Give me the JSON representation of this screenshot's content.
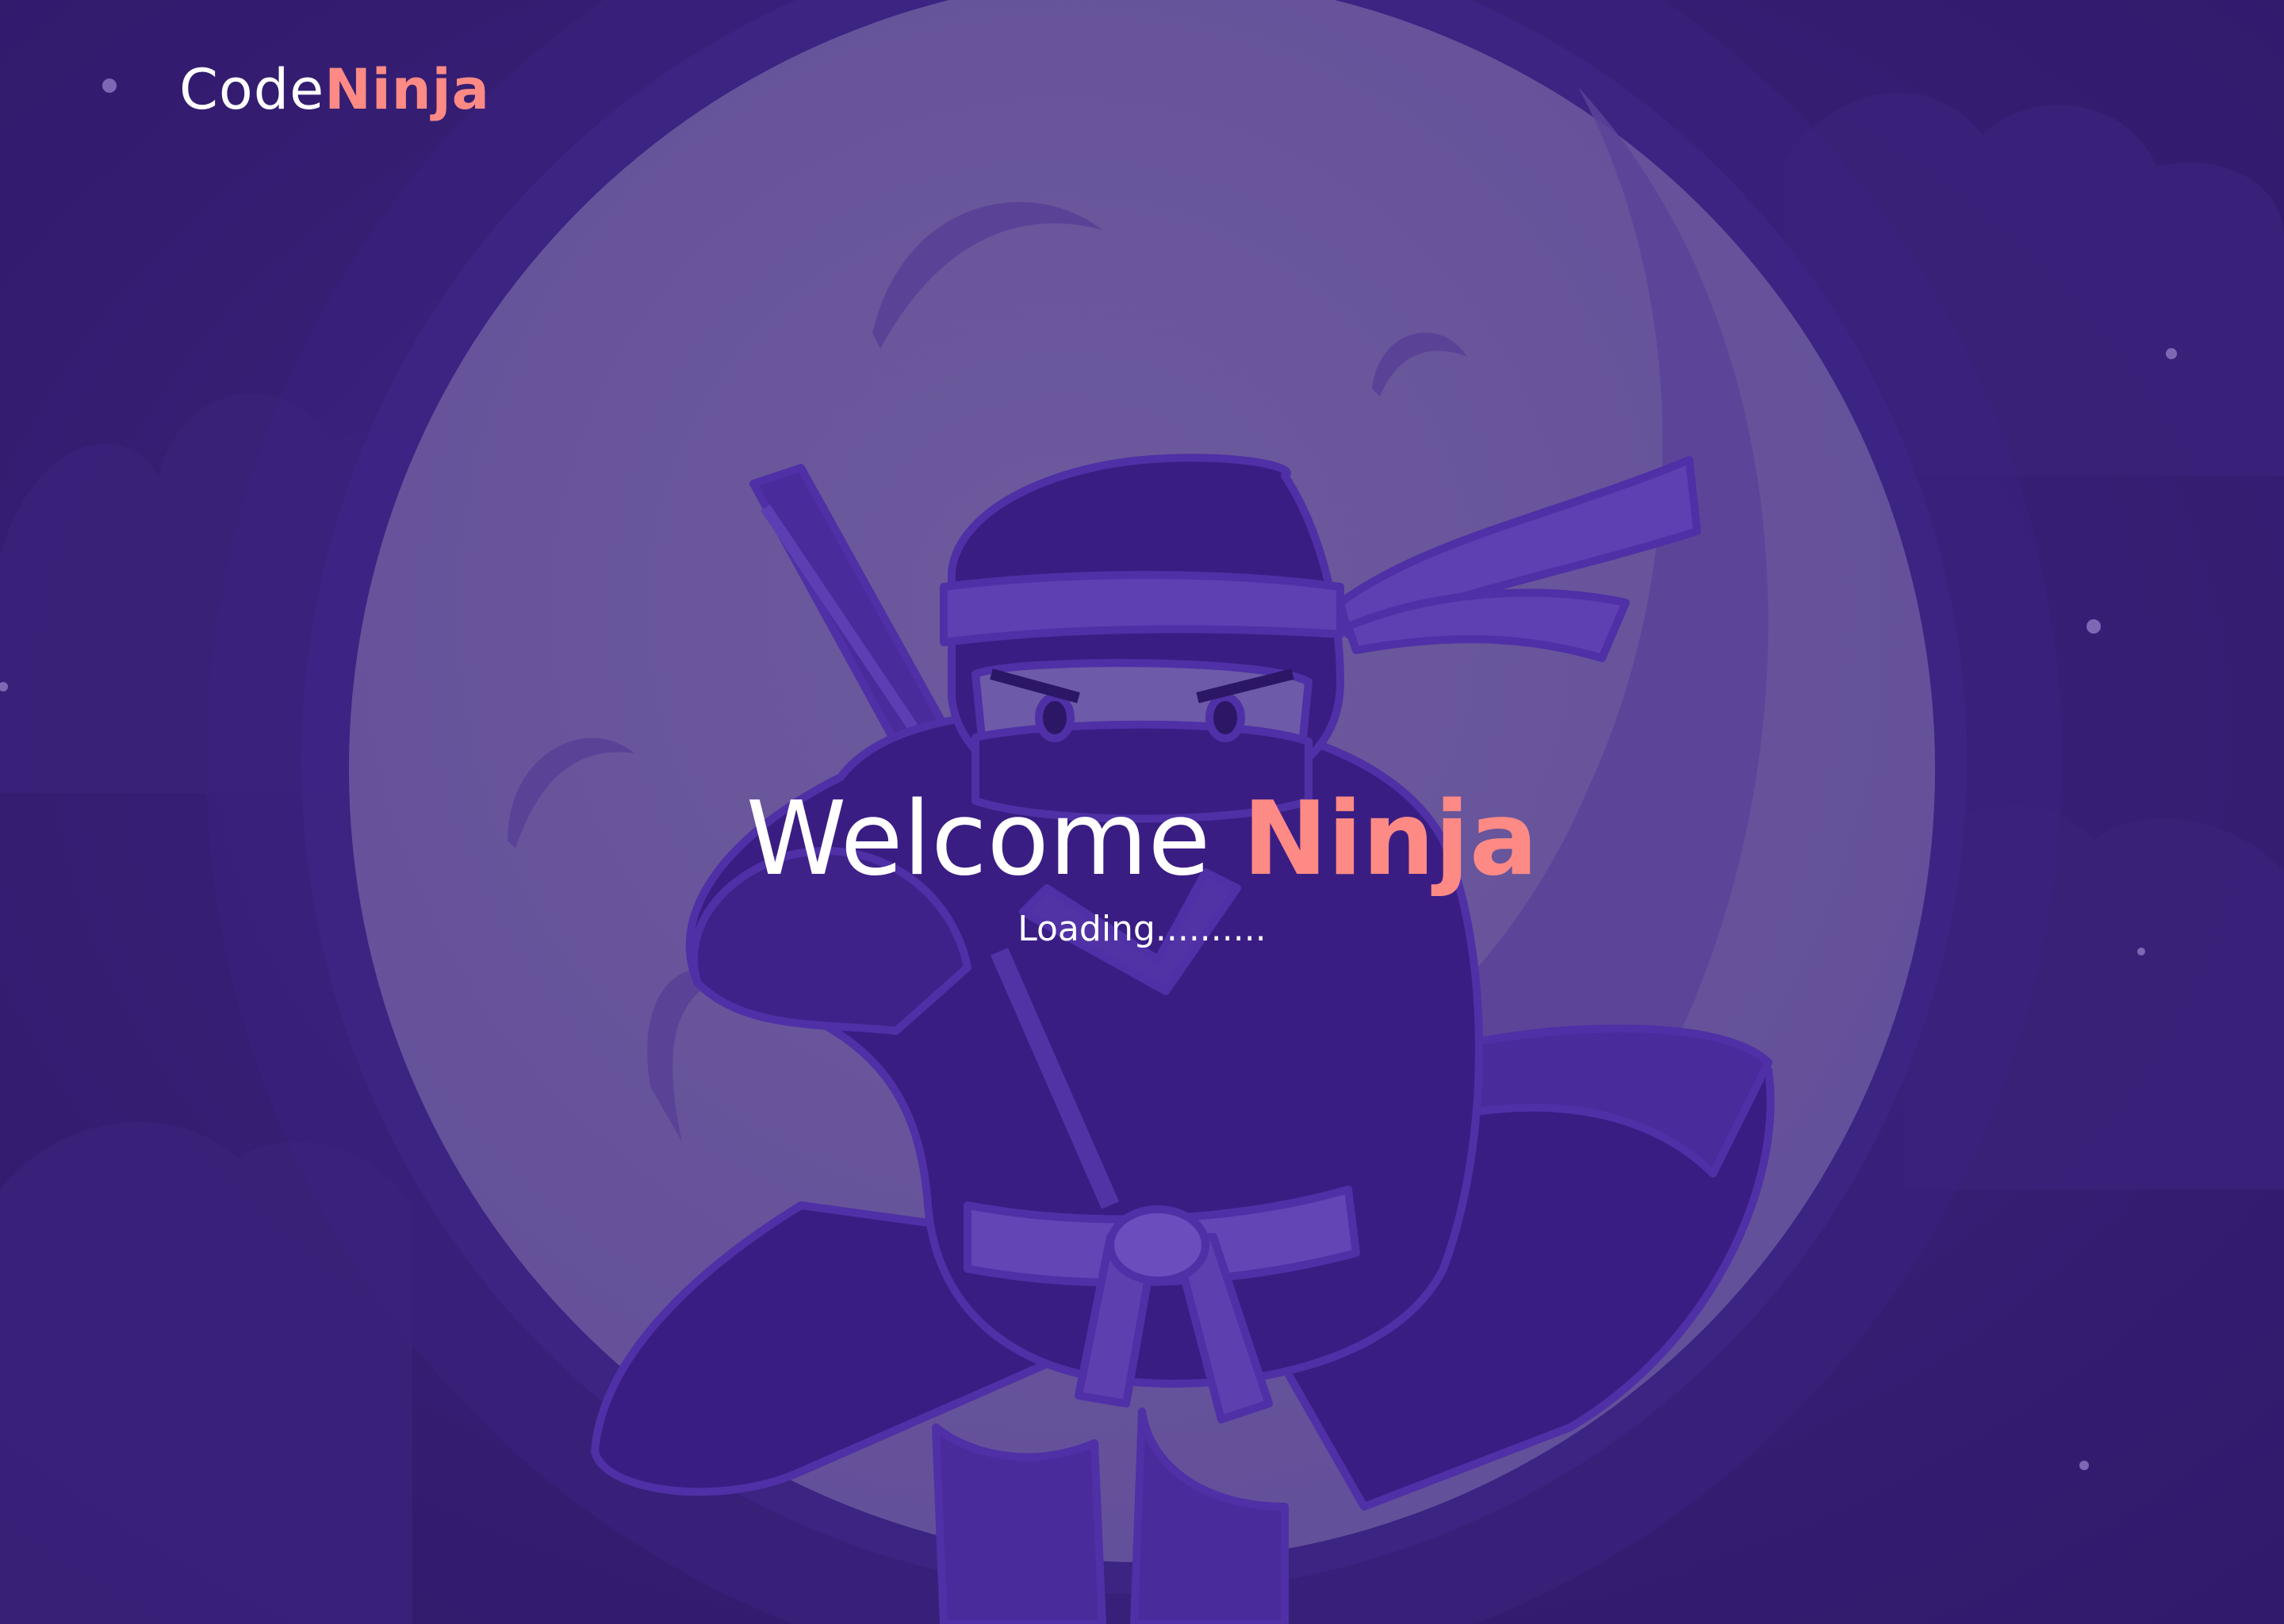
{
  "brand": {
    "part_a": "Code",
    "part_b": "Ninja"
  },
  "hero": {
    "welcome_word": "Welcome",
    "highlight_word": "Ninja",
    "loading_text": "Loading.........."
  },
  "colors": {
    "background": "#341c72",
    "moon": "#6a5699",
    "moon_halo": "#3f2683",
    "ninja_body": "#3d1f86",
    "ninja_outline": "#4a2b9c",
    "accent": "#fd8a85",
    "text": "#ffffff"
  },
  "illustration": {
    "icon": "ninja-mascot-illustration"
  }
}
